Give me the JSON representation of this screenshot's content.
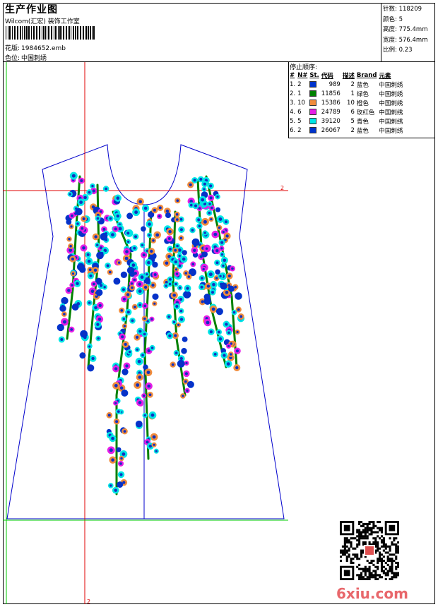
{
  "header": {
    "title": "生产作业图",
    "company": "Wilcom(汇宏) 装饰工作室",
    "file_label": "花版:",
    "file_value": "1984652.emb",
    "colorway_label": "色位:",
    "colorway_value": "中国刺绣"
  },
  "stats": {
    "stitches_label": "针数:",
    "stitches_value": "118209",
    "colors_label": "颜色:",
    "colors_value": "5",
    "height_label": "高度:",
    "height_value": "775.4mm",
    "width_label": "宽度:",
    "width_value": "576.4mm",
    "scale_label": "比例:",
    "scale_value": "0.23"
  },
  "stop_sequence": {
    "title": "停止顺序:",
    "headers": [
      "#",
      "N#",
      "St.",
      "代码",
      "描述",
      "Brand",
      "元素"
    ],
    "rows": [
      {
        "seq": "1.",
        "needle": "2",
        "stitches": "989",
        "code": "2",
        "desc": "蓝色",
        "brand": "中国刺绣",
        "color": "#0033cc"
      },
      {
        "seq": "2.",
        "needle": "1",
        "stitches": "11856",
        "code": "1",
        "desc": "绿色",
        "brand": "中国刺绣",
        "color": "#008000"
      },
      {
        "seq": "3.",
        "needle": "10",
        "stitches": "15386",
        "code": "10",
        "desc": "橙色",
        "brand": "中国刺绣",
        "color": "#f08c3c"
      },
      {
        "seq": "4.",
        "needle": "6",
        "stitches": "24789",
        "code": "6",
        "desc": "玫红色",
        "brand": "中国刺绣",
        "color": "#e61ee6"
      },
      {
        "seq": "5.",
        "needle": "5",
        "stitches": "39120",
        "code": "5",
        "desc": "青色",
        "brand": "中国刺绣",
        "color": "#00e6e6"
      },
      {
        "seq": "6.",
        "needle": "2",
        "stitches": "26067",
        "code": "2",
        "desc": "蓝色",
        "brand": "中国刺绣",
        "color": "#0033cc"
      }
    ]
  },
  "canvas": {
    "markers": {
      "right": "2",
      "bottom": "2"
    },
    "guide_red": "#e00000",
    "guide_green": "#00cc00",
    "outline_blue": "#0000cc"
  },
  "watermark": "6xiu.com"
}
